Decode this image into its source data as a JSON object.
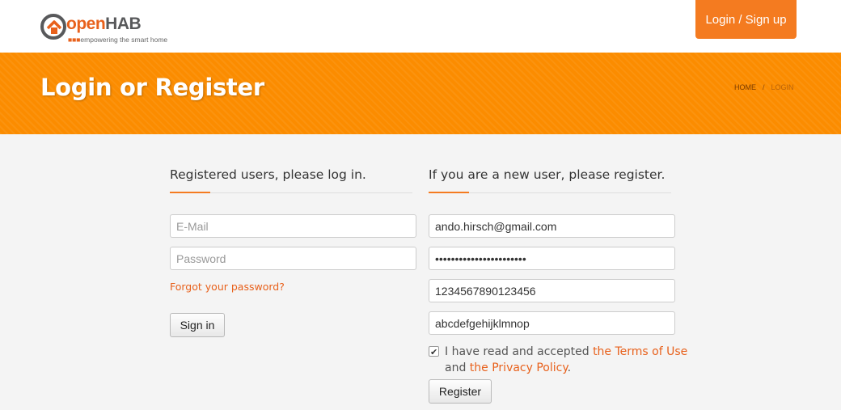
{
  "brand": {
    "name_prefix": "open",
    "name_suffix": "HAB",
    "tagline": "empowering the smart home",
    "tagline_dots": "■■■"
  },
  "header": {
    "login_signup": "Login / Sign up"
  },
  "hero": {
    "title": "Login or Register",
    "breadcrumb": [
      "HOME",
      "LOGIN"
    ],
    "breadcrumb_sep": "/"
  },
  "login": {
    "heading": "Registered users, please log in.",
    "email_placeholder": "E-Mail",
    "password_placeholder": "Password",
    "forgot": "Forgot your password?",
    "submit": "Sign in"
  },
  "register": {
    "heading": "If you are a new user, please register.",
    "email_value": "ando.hirsch@gmail.com",
    "password_value": "•••••••••••••••••••••••",
    "field3_value": "1234567890123456",
    "field4_value": "abcdefgehijklmnop",
    "terms_prefix": "I have read and accepted ",
    "terms_link": "the Terms of Use",
    "terms_and": "and ",
    "privacy_link": "the Privacy Policy",
    "terms_suffix": ".",
    "terms_checked": true,
    "submit": "Register"
  },
  "colors": {
    "accent": "#f47b20",
    "hero": "#fb8c00",
    "link": "#e8611c"
  }
}
